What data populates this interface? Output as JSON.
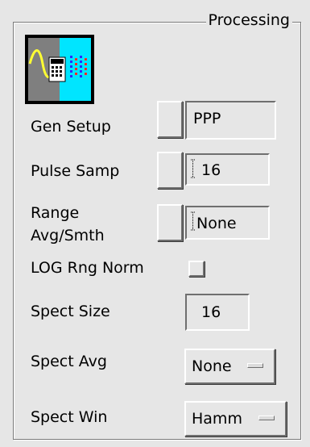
{
  "group": {
    "title": "Processing"
  },
  "icon": {
    "name": "signal-generator-icon",
    "colors": {
      "left": "#7f7f7f",
      "right": "#00e5ff",
      "wave": "#ffff33",
      "dots_blue": "#2a2aff",
      "dots_red": "#ff2a2a"
    }
  },
  "gen_setup": {
    "label": "Gen Setup",
    "value": "PPP"
  },
  "pulse_samp": {
    "label": "Pulse Samp",
    "value": "16"
  },
  "range_avg": {
    "label_line1": "Range",
    "label_line2": "Avg/Smth",
    "value": "None"
  },
  "log_rng_norm": {
    "label": "LOG Rng Norm",
    "checked": false
  },
  "spect_size": {
    "label": "Spect Size",
    "value": "16"
  },
  "spect_avg": {
    "label": "Spect Avg",
    "selected": "None"
  },
  "spect_win": {
    "label": "Spect Win",
    "selected": "Hamm"
  }
}
